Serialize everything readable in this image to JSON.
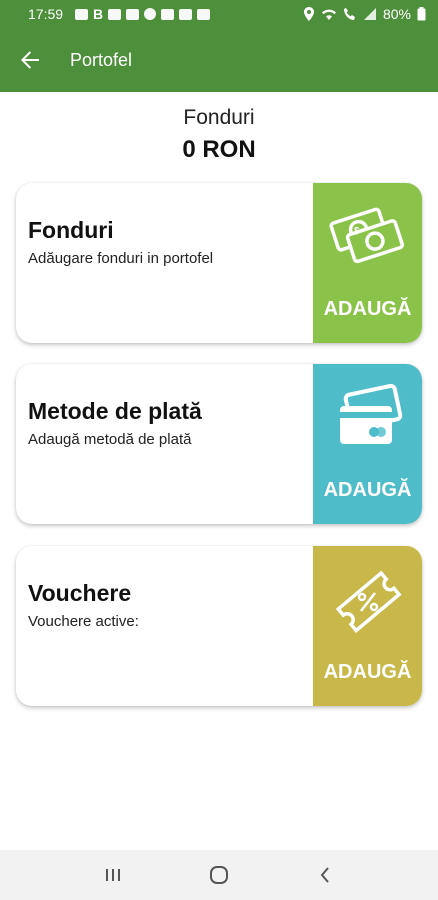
{
  "status_bar": {
    "time": "17:59",
    "battery": "80%",
    "left_icons": [
      "message-icon",
      "b-icon",
      "youtube-icon",
      "youtube-icon",
      "threads-icon",
      "map-icon",
      "mail-icon",
      "image-icon"
    ],
    "right_icons": [
      "location-icon",
      "wifi-icon",
      "call-icon",
      "signal-icon"
    ]
  },
  "app_bar": {
    "title": "Portofel",
    "back_icon": "arrow-left-icon",
    "color": "#4d8f3a"
  },
  "summary": {
    "label": "Fonduri",
    "amount": "0 RON"
  },
  "cards": [
    {
      "title": "Fonduri",
      "subtitle": "Adăugare fonduri in portofel",
      "action_label": "ADAUGĂ",
      "icon": "money-icon",
      "color": "#8bc34a"
    },
    {
      "title": "Metode de plată",
      "subtitle": "Adaugă metodă de plată",
      "action_label": "ADAUGĂ",
      "icon": "credit-card-icon",
      "color": "#4ebdc9"
    },
    {
      "title": "Vouchere",
      "subtitle": "Vouchere active:",
      "action_label": "ADAUGĂ",
      "icon": "voucher-icon",
      "color": "#c8b84a"
    }
  ],
  "nav_bar": {
    "buttons": [
      "recent-apps-icon",
      "home-icon",
      "back-icon"
    ]
  }
}
